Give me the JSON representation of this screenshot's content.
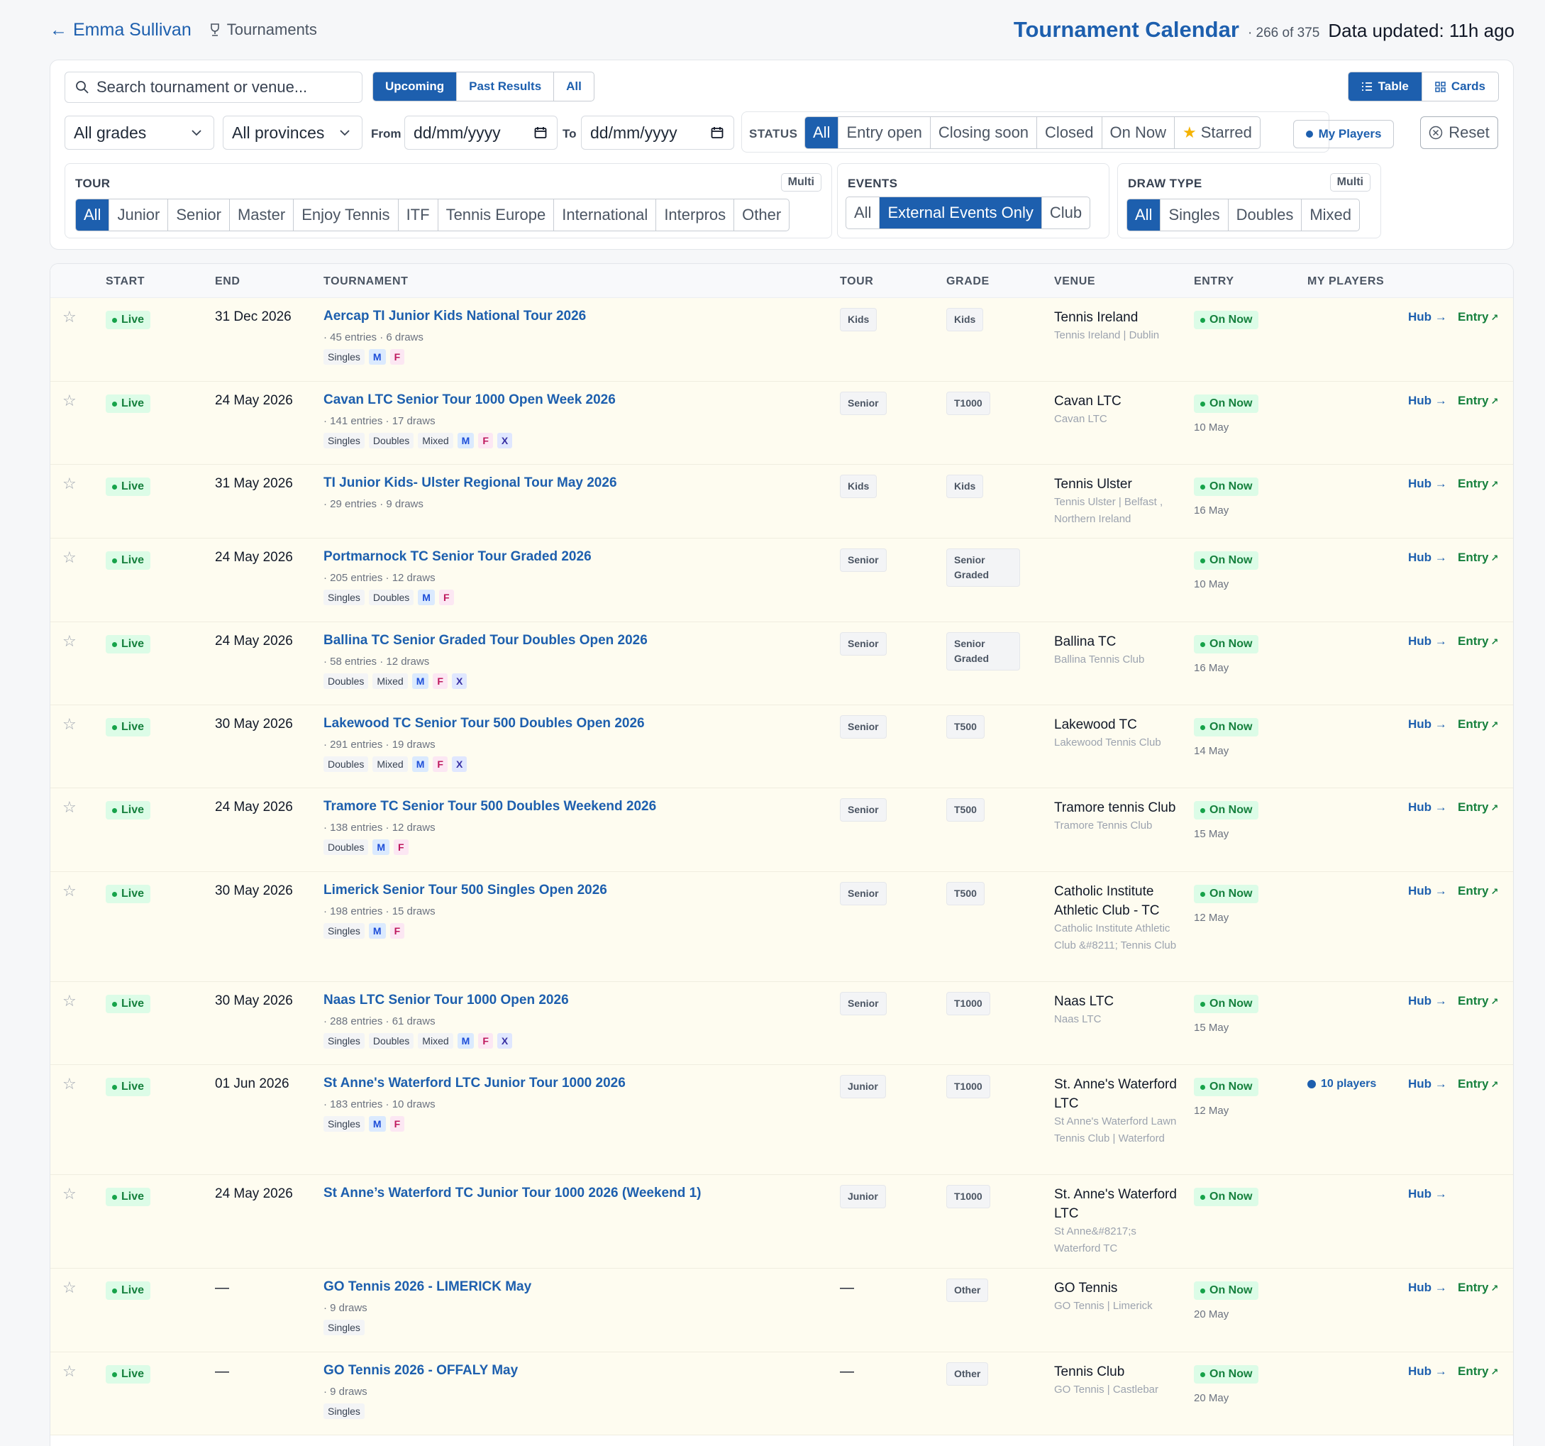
{
  "header": {
    "back_label": "Emma Sullivan",
    "crumb_label": "Tournaments",
    "title": "Tournament Calendar",
    "count": "· 266 of 375",
    "updated": "Data updated: 11h ago"
  },
  "filters": {
    "search_placeholder": "Search tournament or venue...",
    "range_tabs": [
      "Upcoming",
      "Past Results",
      "All"
    ],
    "view_tabs": [
      "Table",
      "Cards"
    ],
    "grades": "All grades",
    "provinces": "All provinces",
    "from_label": "From",
    "to_label": "To",
    "date_placeholder": "dd/mm/yyyy",
    "status_label": "STATUS",
    "status_options": [
      "All",
      "Entry open",
      "Closing soon",
      "Closed",
      "On Now",
      "Starred"
    ],
    "my_players": "My Players",
    "reset": "Reset",
    "tour_label": "TOUR",
    "multi_label": "Multi",
    "tour_options": [
      "All",
      "Junior",
      "Senior",
      "Master",
      "Enjoy Tennis",
      "ITF",
      "Tennis Europe",
      "International",
      "Interpros",
      "Other"
    ],
    "events_label": "EVENTS",
    "events_options": [
      "All",
      "External Events Only",
      "Club"
    ],
    "draw_label": "DRAW TYPE",
    "draw_options": [
      "All",
      "Singles",
      "Doubles",
      "Mixed"
    ]
  },
  "columns": [
    "START",
    "END",
    "TOURNAMENT",
    "TOUR",
    "GRADE",
    "VENUE",
    "ENTRY",
    "MY PLAYERS"
  ],
  "rows": [
    {
      "start": "Live",
      "end": "31 Dec 2026",
      "name": "Aercap TI Junior Kids National Tour 2026",
      "meta": "· 45 entries · 6 draws",
      "chips": [
        "Singles",
        "M",
        "F"
      ],
      "tour": "Kids",
      "grade": "Kids",
      "venue": "Tennis Ireland",
      "venue_sub": "Tennis Ireland | Dublin",
      "entry": "On Now",
      "entry_date": "",
      "players": "",
      "hub": "Hub →",
      "entry_link": "Entry"
    },
    {
      "start": "Live",
      "end": "24 May 2026",
      "name": "Cavan LTC Senior Tour 1000 Open Week 2026",
      "meta": "· 141 entries · 17 draws",
      "chips": [
        "Singles",
        "Doubles",
        "Mixed",
        "M",
        "F",
        "X"
      ],
      "tour": "Senior",
      "grade": "T1000",
      "venue": "Cavan LTC",
      "venue_sub": "Cavan LTC",
      "entry": "On Now",
      "entry_date": "10 May",
      "players": "",
      "hub": "Hub →",
      "entry_link": "Entry"
    },
    {
      "start": "Live",
      "end": "31 May 2026",
      "name": "TI Junior Kids- Ulster Regional Tour May 2026",
      "meta": "· 29 entries · 9 draws",
      "chips": [],
      "tour": "Kids",
      "grade": "Kids",
      "venue": "Tennis Ulster",
      "venue_sub": "Tennis Ulster | Belfast , Northern Ireland",
      "entry": "On Now",
      "entry_date": "16 May",
      "players": "",
      "hub": "Hub →",
      "entry_link": "Entry"
    },
    {
      "start": "Live",
      "end": "24 May 2026",
      "name": "Portmarnock TC Senior Tour Graded 2026",
      "meta": "· 205 entries · 12 draws",
      "chips": [
        "Singles",
        "Doubles",
        "M",
        "F"
      ],
      "tour": "Senior",
      "grade": "Senior Graded",
      "venue": "",
      "venue_sub": "",
      "entry": "On Now",
      "entry_date": "10 May",
      "players": "",
      "hub": "Hub →",
      "entry_link": "Entry"
    },
    {
      "start": "Live",
      "end": "24 May 2026",
      "name": "Ballina TC Senior Graded Tour Doubles Open 2026",
      "meta": "· 58 entries · 12 draws",
      "chips": [
        "Doubles",
        "Mixed",
        "M",
        "F",
        "X"
      ],
      "tour": "Senior",
      "grade": "Senior Graded",
      "venue": "Ballina TC",
      "venue_sub": "Ballina Tennis Club",
      "entry": "On Now",
      "entry_date": "16 May",
      "players": "",
      "hub": "Hub →",
      "entry_link": "Entry"
    },
    {
      "start": "Live",
      "end": "30 May 2026",
      "name": "Lakewood TC Senior Tour 500 Doubles Open 2026",
      "meta": "· 291 entries · 19 draws",
      "chips": [
        "Doubles",
        "Mixed",
        "M",
        "F",
        "X"
      ],
      "tour": "Senior",
      "grade": "T500",
      "venue": "Lakewood TC",
      "venue_sub": "Lakewood Tennis Club",
      "entry": "On Now",
      "entry_date": "14 May",
      "players": "",
      "hub": "Hub →",
      "entry_link": "Entry"
    },
    {
      "start": "Live",
      "end": "24 May 2026",
      "name": "Tramore TC Senior Tour 500 Doubles Weekend 2026",
      "meta": "· 138 entries · 12 draws",
      "chips": [
        "Doubles",
        "M",
        "F"
      ],
      "tour": "Senior",
      "grade": "T500",
      "venue": "Tramore tennis Club",
      "venue_sub": "Tramore Tennis Club",
      "entry": "On Now",
      "entry_date": "15 May",
      "players": "",
      "hub": "Hub →",
      "entry_link": "Entry"
    },
    {
      "start": "Live",
      "end": "30 May 2026",
      "name": "Limerick Senior Tour 500 Singles Open 2026",
      "meta": "· 198 entries · 15 draws",
      "chips": [
        "Singles",
        "M",
        "F"
      ],
      "tour": "Senior",
      "grade": "T500",
      "venue": "Catholic Institute Athletic Club - TC",
      "venue_sub": "Catholic Institute Athletic Club &#8211; Tennis Club",
      "entry": "On Now",
      "entry_date": "12 May",
      "players": "",
      "hub": "Hub →",
      "entry_link": "Entry"
    },
    {
      "start": "Live",
      "end": "30 May 2026",
      "name": "Naas LTC Senior Tour 1000 Open 2026",
      "meta": "· 288 entries · 61 draws",
      "chips": [
        "Singles",
        "Doubles",
        "Mixed",
        "M",
        "F",
        "X"
      ],
      "tour": "Senior",
      "grade": "T1000",
      "venue": "Naas LTC",
      "venue_sub": "Naas LTC",
      "entry": "On Now",
      "entry_date": "15 May",
      "players": "",
      "hub": "Hub →",
      "entry_link": "Entry"
    },
    {
      "start": "Live",
      "end": "01 Jun 2026",
      "name": "St Anne's Waterford LTC Junior Tour 1000 2026",
      "meta": "· 183 entries · 10 draws",
      "chips": [
        "Singles",
        "M",
        "F"
      ],
      "tour": "Junior",
      "grade": "T1000",
      "venue": "St. Anne's Waterford LTC",
      "venue_sub": "St Anne's Waterford Lawn Tennis Club | Waterford",
      "entry": "On Now",
      "entry_date": "12 May",
      "players": "10 players",
      "hub": "Hub →",
      "entry_link": "Entry"
    },
    {
      "start": "Live",
      "end": "24 May 2026",
      "name": "St Anne’s Waterford TC Junior Tour 1000 2026 (Weekend 1)",
      "meta": "",
      "chips": [],
      "tour": "Junior",
      "grade": "T1000",
      "venue": "St. Anne's Waterford LTC",
      "venue_sub": "St Anne&#8217;s Waterford TC",
      "entry": "On Now",
      "entry_date": "",
      "players": "",
      "hub": "Hub →",
      "entry_link": ""
    },
    {
      "start": "Live",
      "end": "—",
      "name": "GO Tennis 2026 - LIMERICK May",
      "meta": "· 9 draws",
      "chips": [
        "Singles"
      ],
      "tour": "—",
      "grade": "Other",
      "venue": "GO Tennis",
      "venue_sub": "GO Tennis | Limerick",
      "entry": "On Now",
      "entry_date": "20 May",
      "players": "",
      "hub": "Hub →",
      "entry_link": "Entry"
    },
    {
      "start": "Live",
      "end": "—",
      "name": "GO Tennis 2026 - OFFALY May",
      "meta": "· 9 draws",
      "chips": [
        "Singles"
      ],
      "tour": "—",
      "grade": "Other",
      "venue": "Tennis Club",
      "venue_sub": "GO Tennis | Castlebar",
      "entry": "On Now",
      "entry_date": "20 May",
      "players": "",
      "hub": "Hub →",
      "entry_link": "Entry"
    }
  ],
  "colors": {
    "accent": "#1d5fae",
    "live_bg": "#dcfce7",
    "live_fg": "#15803d",
    "row_bg": "#fefcf0"
  }
}
